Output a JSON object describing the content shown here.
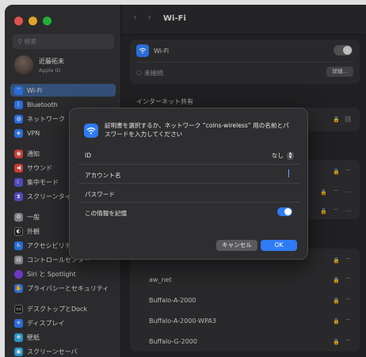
{
  "window": {
    "search_placeholder": "検索",
    "profile": {
      "name": "近藤拓未",
      "subtitle": "Apple ID"
    },
    "sidebar": [
      {
        "label": "Wi-Fi",
        "icon": "wifi-icon",
        "color": "#2f7bf5",
        "selected": true
      },
      {
        "label": "Bluetooth",
        "icon": "bluetooth-icon",
        "color": "#2f7bf5"
      },
      {
        "label": "ネットワーク",
        "icon": "globe-icon",
        "color": "#2f7bf5"
      },
      {
        "label": "VPN",
        "icon": "vpn-icon",
        "color": "#2f7bf5"
      },
      {
        "label": "通知",
        "icon": "bell-icon",
        "color": "#e2453c"
      },
      {
        "label": "サウンド",
        "icon": "speaker-icon",
        "color": "#e2453c"
      },
      {
        "label": "集中モード",
        "icon": "moon-icon",
        "color": "#5a55d6"
      },
      {
        "label": "スクリーンタイム",
        "icon": "hourglass-icon",
        "color": "#5a55d6"
      },
      {
        "label": "一般",
        "icon": "gear-icon",
        "color": "#8e8e93"
      },
      {
        "label": "外観",
        "icon": "appearance-icon",
        "color": "#1c1c1e"
      },
      {
        "label": "アクセシビリティ",
        "icon": "accessibility-icon",
        "color": "#2f7bf5"
      },
      {
        "label": "コントロールセンター",
        "icon": "control-center-icon",
        "color": "#8e8e93"
      },
      {
        "label": "Siri と Spotlight",
        "icon": "siri-icon",
        "color": "#7b3fe4"
      },
      {
        "label": "プライバシーとセキュリティ",
        "icon": "hand-icon",
        "color": "#2f7bf5"
      },
      {
        "label": "デスクトップとDock",
        "icon": "dock-icon",
        "color": "#1c1c1e"
      },
      {
        "label": "ディスプレイ",
        "icon": "display-icon",
        "color": "#2f7bf5"
      },
      {
        "label": "壁紙",
        "icon": "wallpaper-icon",
        "color": "#2fa7e0"
      },
      {
        "label": "スクリーンセーバ",
        "icon": "screensaver-icon",
        "color": "#2fa7e0"
      }
    ],
    "main": {
      "title": "Wi-Fi",
      "wifi_label": "Wi-Fi",
      "status": "未接続",
      "details_button": "詳細...",
      "hotspot_header": "インターネット共有",
      "networks": [
        "aw_net",
        "Buffalo-A-2000",
        "Buffalo-A-2000-WPA3",
        "Buffalo-G-2000"
      ]
    }
  },
  "dialog": {
    "message": "証明書を選択するか、ネットワーク “coins-wireless” 用の名前とパスワードを入力してください",
    "id_label": "ID",
    "id_value": "なし",
    "account_label": "アカウント名",
    "password_label": "パスワード",
    "remember_label": "この情報を記憶",
    "remember_on": true,
    "cancel_button": "キャンセル",
    "ok_button": "OK"
  }
}
